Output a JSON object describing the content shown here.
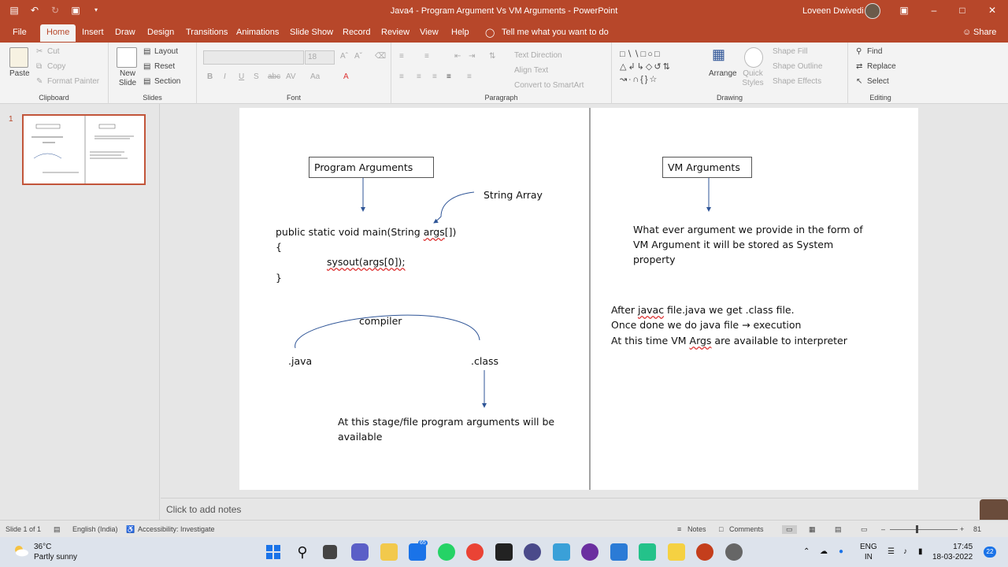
{
  "window": {
    "title": "Java4 - Program Argument Vs VM Arguments - PowerPoint",
    "user_name": "Loveen Dwivedi"
  },
  "tabs": [
    "File",
    "Home",
    "Insert",
    "Draw",
    "Design",
    "Transitions",
    "Animations",
    "Slide Show",
    "Record",
    "Review",
    "View",
    "Help"
  ],
  "tell_me": "Tell me what you want to do",
  "share_label": "Share",
  "ribbon": {
    "clipboard": {
      "paste": "Paste",
      "cut": "Cut",
      "copy": "Copy",
      "format_painter": "Format Painter",
      "label": "Clipboard"
    },
    "slides": {
      "new_slide": "New Slide",
      "layout": "Layout",
      "reset": "Reset",
      "section": "Section",
      "label": "Slides"
    },
    "font": {
      "size": "18",
      "label": "Font"
    },
    "paragraph": {
      "text_direction": "Text Direction",
      "align_text": "Align Text",
      "smartart": "Convert to SmartArt",
      "label": "Paragraph"
    },
    "drawing": {
      "arrange": "Arrange",
      "quick_styles": "Quick Styles",
      "shape_fill": "Shape Fill",
      "shape_outline": "Shape Outline",
      "shape_effects": "Shape Effects",
      "label": "Drawing"
    },
    "editing": {
      "find": "Find",
      "replace": "Replace",
      "select": "Select",
      "label": "Editing"
    }
  },
  "thumbnail": {
    "number": "1"
  },
  "slide": {
    "left": {
      "box_title": "Program Arguments",
      "string_array": "String Array",
      "code_line1_prefix": "public static void main(String ",
      "code_line1_args": "args",
      "code_line1_suffix": "[])",
      "open_brace": "{",
      "code_line2": "sysout(args[0]);",
      "close_brace": "}",
      "compiler": "compiler",
      "java": ".java",
      "class": ".class",
      "stage_line1": "At this stage/file program arguments will be",
      "stage_line2": "available"
    },
    "right": {
      "box_title": "VM Arguments",
      "desc_line1": "What ever argument we provide in the form of",
      "desc_line2": "VM Argument it will be stored as System",
      "desc_line3": "property",
      "after_line1_a": "After ",
      "after_line1_javac": "javac",
      "after_line1_b": " file.java we get .class file.",
      "after_line2": "Once done we do java file → execution",
      "after_line3_a": "At this time VM ",
      "after_line3_args": "Args",
      "after_line3_b": " are available to interpreter"
    }
  },
  "notes_placeholder": "Click to add notes",
  "status": {
    "slide": "Slide 1 of 1",
    "language": "English (India)",
    "accessibility": "Accessibility: Investigate",
    "notes": "Notes",
    "comments": "Comments",
    "zoom": "81"
  },
  "taskbar": {
    "temperature": "36°C",
    "weather": "Partly sunny",
    "lang1": "ENG",
    "lang2": "IN",
    "time": "17:45",
    "date": "18-03-2022",
    "notification_count": "22",
    "mail_badge": "65"
  },
  "colors": {
    "accent": "#b7472a",
    "arrow": "#2f5597"
  }
}
